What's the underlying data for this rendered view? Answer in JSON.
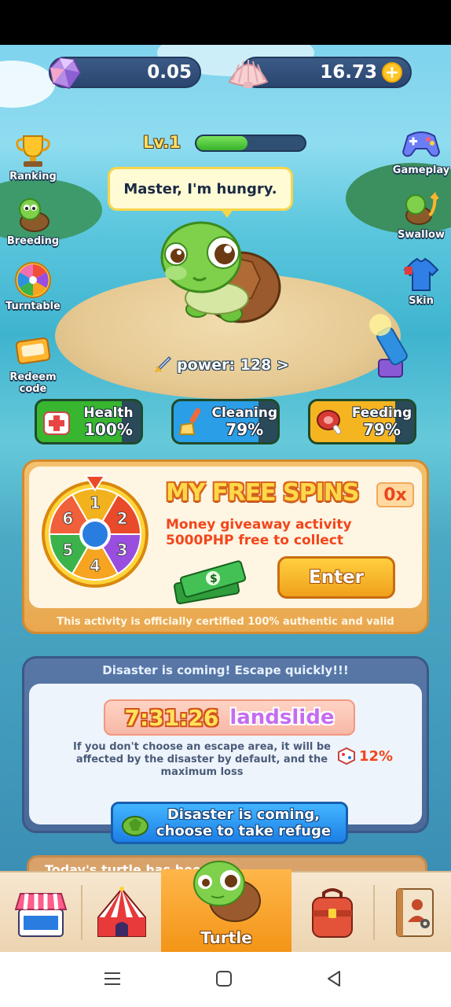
{
  "currency": {
    "gem_value": "0.05",
    "shell_value": "16.73",
    "plus_symbol": "+"
  },
  "level": {
    "label": "Lv.1",
    "progress": 0.47
  },
  "side_left": [
    {
      "label": "Ranking",
      "icon": "trophy-icon"
    },
    {
      "label": "Breeding",
      "icon": "baby-turtle-icon"
    },
    {
      "label": "Turntable",
      "icon": "wheel-icon"
    },
    {
      "label": "Redeem code",
      "icon": "coupon-icon"
    }
  ],
  "side_right": [
    {
      "label": "Gameplay",
      "icon": "gamepad-icon"
    },
    {
      "label": "Swallow",
      "icon": "turtle-arrow-icon"
    },
    {
      "label": "Skin",
      "icon": "shirt-icon"
    }
  ],
  "speech": "Master, I'm hungry.",
  "power": "power: 128 >",
  "stats": [
    {
      "name": "Health",
      "value": "100%",
      "color": "#38b62f"
    },
    {
      "name": "Cleaning",
      "value": "79%",
      "color": "#2a9ee6"
    },
    {
      "name": "Feeding",
      "value": "79%",
      "color": "#f5b521"
    }
  ],
  "spins": {
    "title": "MY FREE SPINS",
    "count": "0x",
    "desc_line1": "Money giveaway activity",
    "desc_line2": "5000PHP free to collect",
    "enter_label": "Enter",
    "footer": "This activity is officially certified 100% authentic and valid",
    "wheel_numbers": [
      "1",
      "2",
      "3",
      "4",
      "5",
      "6"
    ]
  },
  "disaster": {
    "title": "Disaster is coming! Escape quickly!!!",
    "timer": "7:31:26",
    "type": "landslide",
    "note": "If you don't choose an escape area, it will be affected by the disaster by default, and the maximum loss",
    "loss": "12%",
    "button_line1": "Disaster is coming,",
    "button_line2": "choose to take refuge"
  },
  "today_text": "Today's turtle has been",
  "tabs": [
    {
      "icon": "shop-icon"
    },
    {
      "icon": "circus-tent-icon"
    },
    {
      "label": "Turtle",
      "icon": "turtle-icon",
      "active": true
    },
    {
      "icon": "backpack-icon"
    },
    {
      "icon": "profile-book-icon"
    }
  ]
}
